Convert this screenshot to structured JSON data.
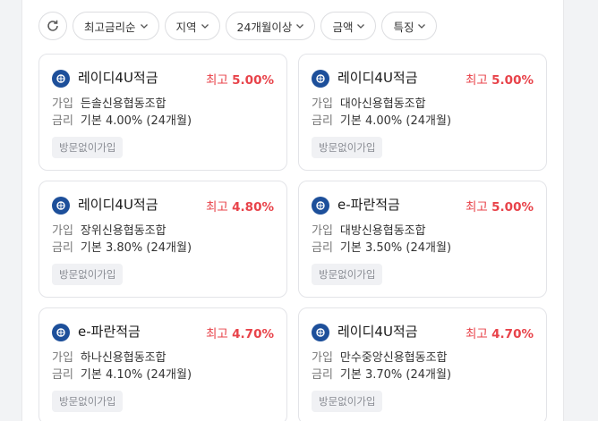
{
  "filters": {
    "chips": [
      {
        "label": "최고금리순"
      },
      {
        "label": "지역"
      },
      {
        "label": "24개월이상"
      },
      {
        "label": "금액"
      },
      {
        "label": "특징"
      }
    ]
  },
  "colors": {
    "accent_rate": "#e8434a",
    "logo_bg": "#1d4f9a"
  },
  "labels": {
    "join": "가입",
    "rate": "금리",
    "max_prefix": "최고"
  },
  "products": [
    {
      "name": "레이디4U적금",
      "max_rate": "5.00%",
      "bank": "든솔신용협동조합",
      "base": "기본 4.00% (24개월)",
      "badge": "방문없이가입"
    },
    {
      "name": "레이디4U적금",
      "max_rate": "5.00%",
      "bank": "대아신용협동조합",
      "base": "기본 4.00% (24개월)",
      "badge": "방문없이가입"
    },
    {
      "name": "레이디4U적금",
      "max_rate": "4.80%",
      "bank": "장위신용협동조합",
      "base": "기본 3.80% (24개월)",
      "badge": "방문없이가입"
    },
    {
      "name": "e-파란적금",
      "max_rate": "5.00%",
      "bank": "대방신용협동조합",
      "base": "기본 3.50% (24개월)",
      "badge": "방문없이가입"
    },
    {
      "name": "e-파란적금",
      "max_rate": "4.70%",
      "bank": "하나신용협동조합",
      "base": "기본 4.10% (24개월)",
      "badge": "방문없이가입"
    },
    {
      "name": "레이디4U적금",
      "max_rate": "4.70%",
      "bank": "만수중앙신용협동조합",
      "base": "기본 3.70% (24개월)",
      "badge": "방문없이가입"
    }
  ]
}
